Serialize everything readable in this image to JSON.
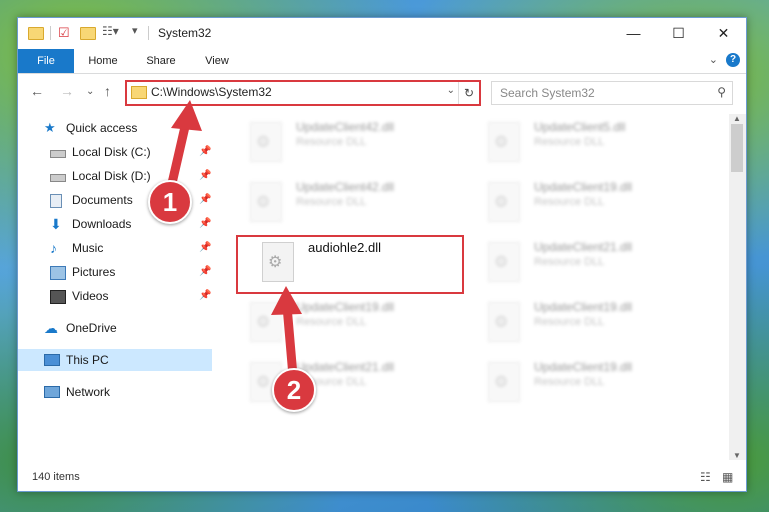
{
  "window": {
    "title": "System32",
    "controls": {
      "minimize": "—",
      "maximize": "☐",
      "close": "✕"
    }
  },
  "ribbon": {
    "tabs": [
      "File",
      "Home",
      "Share",
      "View"
    ],
    "help": "?"
  },
  "navbar": {
    "address": "C:\\Windows\\System32",
    "search_placeholder": "Search System32"
  },
  "sidebar": {
    "items": [
      {
        "label": "Quick access",
        "icon": "star-icon"
      },
      {
        "label": "Local Disk (C:)",
        "icon": "drive-icon",
        "pinned": true
      },
      {
        "label": "Local Disk (D:)",
        "icon": "drive-icon",
        "pinned": true
      },
      {
        "label": "Documents",
        "icon": "documents-icon",
        "pinned": true
      },
      {
        "label": "Downloads",
        "icon": "download-icon",
        "pinned": true
      },
      {
        "label": "Music",
        "icon": "music-icon",
        "pinned": true
      },
      {
        "label": "Pictures",
        "icon": "pictures-icon",
        "pinned": true
      },
      {
        "label": "Videos",
        "icon": "videos-icon",
        "pinned": true
      },
      {
        "label": "OneDrive",
        "icon": "cloud-icon"
      },
      {
        "label": "This PC",
        "icon": "computer-icon",
        "selected": true
      },
      {
        "label": "Network",
        "icon": "network-icon"
      }
    ]
  },
  "files": [
    {
      "name": "UpdateClient42.dll",
      "type": "Resource DLL"
    },
    {
      "name": "UpdateClient5.dll",
      "type": "Resource DLL"
    },
    {
      "name": "UpdateClient42.dll",
      "type": "Resource DLL"
    },
    {
      "name": "UpdateClient19.dll",
      "type": "Resource DLL"
    },
    {
      "name": "audiohle2.dll",
      "type": ""
    },
    {
      "name": "UpdateClient21.dll",
      "type": "Resource DLL"
    },
    {
      "name": "UpdateClient19.dll",
      "type": "Resource DLL"
    },
    {
      "name": "UpdateClient19.dll",
      "type": "Resource DLL"
    },
    {
      "name": "UpdateClient21.dll",
      "type": "Resource DLL"
    },
    {
      "name": "UpdateClient19.dll",
      "type": "Resource DLL"
    }
  ],
  "status": {
    "count": "140 items"
  },
  "annotations": {
    "step1": "1",
    "step2": "2"
  },
  "colors": {
    "accent": "#1979ca",
    "highlight": "#d9393f",
    "selected": "#cce8ff"
  }
}
